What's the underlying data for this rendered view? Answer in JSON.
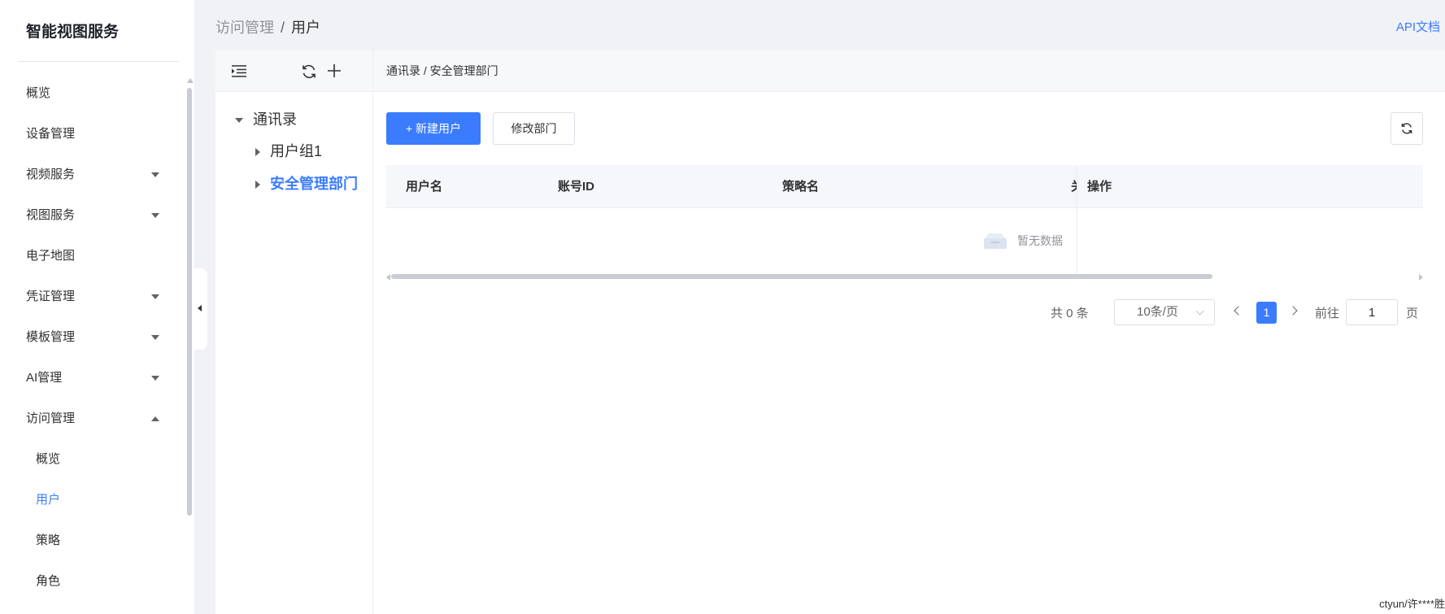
{
  "app": {
    "title": "智能视图服务",
    "api_link": "API文档",
    "watermark": "ctyun/许****胜"
  },
  "sidebar": {
    "items": [
      {
        "label": "概览",
        "expandable": false
      },
      {
        "label": "设备管理",
        "expandable": false
      },
      {
        "label": "视频服务",
        "expandable": true
      },
      {
        "label": "视图服务",
        "expandable": true
      },
      {
        "label": "电子地图",
        "expandable": false
      },
      {
        "label": "凭证管理",
        "expandable": true
      },
      {
        "label": "模板管理",
        "expandable": true
      },
      {
        "label": "AI管理",
        "expandable": true
      },
      {
        "label": "访问管理",
        "expandable": true,
        "expanded": true
      }
    ],
    "subitems": [
      {
        "label": "概览",
        "active": false
      },
      {
        "label": "用户",
        "active": true
      },
      {
        "label": "策略",
        "active": false
      },
      {
        "label": "角色",
        "active": false
      }
    ]
  },
  "breadcrumb": {
    "parent": "访问管理",
    "separator": "/",
    "current": "用户"
  },
  "tree": {
    "nodes": [
      {
        "label": "通讯录",
        "level": 0,
        "expanded": true
      },
      {
        "label": "用户组1",
        "level": 1,
        "expanded": false
      },
      {
        "label": "安全管理部门",
        "level": 1,
        "expanded": false,
        "active": true
      }
    ]
  },
  "content": {
    "path": "通讯录 / 安全管理部门",
    "new_user_button": "+ 新建用户",
    "edit_dept_button": "修改部门",
    "table": {
      "columns": [
        "用户名",
        "账号ID",
        "策略名",
        "关",
        "操作"
      ],
      "rows": [],
      "empty_text": "暂无数据"
    },
    "pagination": {
      "total_text": "共 0 条",
      "page_size": "10条/页",
      "current_page": "1",
      "goto_label": "前往",
      "goto_value": "1",
      "unit": "页"
    }
  },
  "colors": {
    "accent": "#3b7cff",
    "background": "#f0f2f5"
  }
}
